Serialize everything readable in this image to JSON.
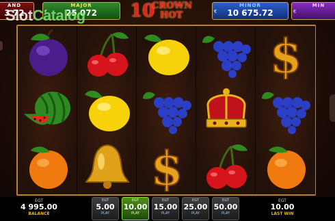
{
  "logo": {
    "number": "10",
    "word1": "CROWN",
    "word2": "HOT"
  },
  "watermark": {
    "part1": "Slot",
    "part2": "Catalog"
  },
  "jackpots": {
    "grand": {
      "label": "AND",
      "value": "3 72"
    },
    "major": {
      "label": "MAJOR",
      "currency": "€",
      "value": "25 072"
    },
    "minor": {
      "label": "MINOR",
      "currency": "€",
      "value": "10 675.72"
    },
    "mini": {
      "label": "MIN",
      "currency": "€"
    }
  },
  "reels": [
    [
      "plum",
      "watermelon",
      "orange"
    ],
    [
      "cherries",
      "lemon",
      "bell"
    ],
    [
      "lemon",
      "grapes",
      "dollar"
    ],
    [
      "grapes",
      "crown",
      "cherries"
    ],
    [
      "dollar",
      "grapes",
      "orange"
    ]
  ],
  "bottom": {
    "balance": {
      "currency": "EGT",
      "amount": "4 995.00",
      "label": "BALANCE"
    },
    "bets": [
      {
        "currency": "EGT",
        "value": "5.00",
        "label": "PLAY"
      },
      {
        "currency": "EGT",
        "value": "10.00",
        "label": "PLAY"
      },
      {
        "currency": "EGT",
        "value": "15.00",
        "label": "PLAY"
      },
      {
        "currency": "EGT",
        "value": "25.00",
        "label": "PLAY"
      },
      {
        "currency": "EGT",
        "value": "50.00",
        "label": "PLAY"
      }
    ],
    "active_bet": "10.00",
    "last_win": {
      "currency": "EGT",
      "amount": "10.00",
      "label": "LAST WIN"
    }
  },
  "colors": {
    "reel_frame": "#b4842e",
    "active_bet": "#4d8f1d",
    "label_accent": "#f2b900"
  }
}
